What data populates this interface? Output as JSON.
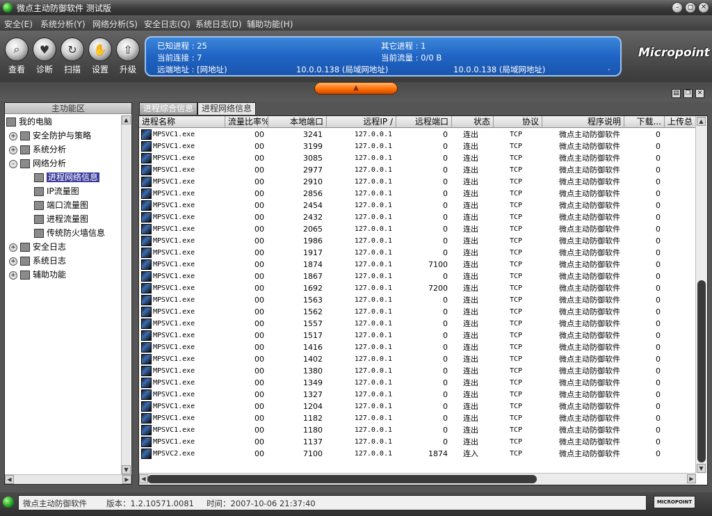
{
  "window": {
    "title": "微点主动防御软件  测试版",
    "btn_min": "–",
    "btn_restore": "◻",
    "btn_close": "✕"
  },
  "menu": [
    "安全(E)",
    "系统分析(Y)",
    "网络分析(S)",
    "安全日志(Q)",
    "系统日志(D)",
    "辅助功能(H)"
  ],
  "toolbar": {
    "buttons": [
      {
        "label": "查看",
        "icon": "magnifier-icon"
      },
      {
        "label": "诊断",
        "icon": "heartbeat-icon"
      },
      {
        "label": "扫描",
        "icon": "scan-icon"
      },
      {
        "label": "设置",
        "icon": "settings-icon"
      },
      {
        "label": "升级",
        "icon": "upgrade-icon"
      }
    ]
  },
  "info": {
    "known_processes": "已知进程 : 25",
    "other_processes": "其它进程 : 1",
    "current_connections": "当前连接 : 7",
    "current_traffic": "当前流量 : 0/0 B",
    "remote_address": "远端地址 : [网地址)",
    "addr1": "10.0.0.138 (局域网地址)",
    "addr2": "10.0.0.138 (局域网地址)",
    "dot": "."
  },
  "brand": "Micropoint",
  "left": {
    "header": "主功能区",
    "tree": [
      {
        "label": "我的电脑",
        "level": 0,
        "expander": "",
        "icon": "computer-icon"
      },
      {
        "label": "安全防护与策略",
        "level": 1,
        "expander": "+",
        "icon": "shield-icon"
      },
      {
        "label": "系统分析",
        "level": 1,
        "expander": "+",
        "icon": "system-icon"
      },
      {
        "label": "网络分析",
        "level": 1,
        "expander": "-",
        "icon": "network-icon"
      },
      {
        "label": "进程网络信息",
        "level": 2,
        "expander": "",
        "icon": "process-net-icon",
        "selected": true
      },
      {
        "label": "IP流量图",
        "level": 2,
        "expander": "",
        "icon": "chart-icon"
      },
      {
        "label": "端口流量图",
        "level": 2,
        "expander": "",
        "icon": "chart-icon"
      },
      {
        "label": "进程流量图",
        "level": 2,
        "expander": "",
        "icon": "chart-icon"
      },
      {
        "label": "传统防火墙信息",
        "level": 2,
        "expander": "",
        "icon": "firewall-icon"
      },
      {
        "label": "安全日志",
        "level": 1,
        "expander": "+",
        "icon": "log-icon"
      },
      {
        "label": "系统日志",
        "level": 1,
        "expander": "+",
        "icon": "log-icon"
      },
      {
        "label": "辅助功能",
        "level": 1,
        "expander": "+",
        "icon": "tools-icon"
      }
    ]
  },
  "tabs": [
    "进程综合信息",
    "进程网络信息"
  ],
  "grid": {
    "columns": [
      "进程名称",
      "流量比率%",
      "本地端口",
      "远程IP /",
      "远程端口",
      "状态",
      "协议",
      "程序说明",
      "下载...",
      "上传总"
    ],
    "rows": [
      [
        "MPSVC1.exe",
        "00",
        "3241",
        "127.0.0.1",
        "0",
        "连出",
        "TCP",
        "微点主动防御软件",
        "0"
      ],
      [
        "MPSVC1.exe",
        "00",
        "3199",
        "127.0.0.1",
        "0",
        "连出",
        "TCP",
        "微点主动防御软件",
        "0"
      ],
      [
        "MPSVC1.exe",
        "00",
        "3085",
        "127.0.0.1",
        "0",
        "连出",
        "TCP",
        "微点主动防御软件",
        "0"
      ],
      [
        "MPSVC1.exe",
        "00",
        "2977",
        "127.0.0.1",
        "0",
        "连出",
        "TCP",
        "微点主动防御软件",
        "0"
      ],
      [
        "MPSVC1.exe",
        "00",
        "2910",
        "127.0.0.1",
        "0",
        "连出",
        "TCP",
        "微点主动防御软件",
        "0"
      ],
      [
        "MPSVC1.exe",
        "00",
        "2856",
        "127.0.0.1",
        "0",
        "连出",
        "TCP",
        "微点主动防御软件",
        "0"
      ],
      [
        "MPSVC1.exe",
        "00",
        "2454",
        "127.0.0.1",
        "0",
        "连出",
        "TCP",
        "微点主动防御软件",
        "0"
      ],
      [
        "MPSVC1.exe",
        "00",
        "2432",
        "127.0.0.1",
        "0",
        "连出",
        "TCP",
        "微点主动防御软件",
        "0"
      ],
      [
        "MPSVC1.exe",
        "00",
        "2065",
        "127.0.0.1",
        "0",
        "连出",
        "TCP",
        "微点主动防御软件",
        "0"
      ],
      [
        "MPSVC1.exe",
        "00",
        "1986",
        "127.0.0.1",
        "0",
        "连出",
        "TCP",
        "微点主动防御软件",
        "0"
      ],
      [
        "MPSVC1.exe",
        "00",
        "1917",
        "127.0.0.1",
        "0",
        "连出",
        "TCP",
        "微点主动防御软件",
        "0"
      ],
      [
        "MPSVC1.exe",
        "00",
        "1874",
        "127.0.0.1",
        "7100",
        "连出",
        "TCP",
        "微点主动防御软件",
        "0"
      ],
      [
        "MPSVC1.exe",
        "00",
        "1867",
        "127.0.0.1",
        "0",
        "连出",
        "TCP",
        "微点主动防御软件",
        "0"
      ],
      [
        "MPSVC1.exe",
        "00",
        "1692",
        "127.0.0.1",
        "7200",
        "连出",
        "TCP",
        "微点主动防御软件",
        "0"
      ],
      [
        "MPSVC1.exe",
        "00",
        "1563",
        "127.0.0.1",
        "0",
        "连出",
        "TCP",
        "微点主动防御软件",
        "0"
      ],
      [
        "MPSVC1.exe",
        "00",
        "1562",
        "127.0.0.1",
        "0",
        "连出",
        "TCP",
        "微点主动防御软件",
        "0"
      ],
      [
        "MPSVC1.exe",
        "00",
        "1557",
        "127.0.0.1",
        "0",
        "连出",
        "TCP",
        "微点主动防御软件",
        "0"
      ],
      [
        "MPSVC1.exe",
        "00",
        "1517",
        "127.0.0.1",
        "0",
        "连出",
        "TCP",
        "微点主动防御软件",
        "0"
      ],
      [
        "MPSVC1.exe",
        "00",
        "1416",
        "127.0.0.1",
        "0",
        "连出",
        "TCP",
        "微点主动防御软件",
        "0"
      ],
      [
        "MPSVC1.exe",
        "00",
        "1402",
        "127.0.0.1",
        "0",
        "连出",
        "TCP",
        "微点主动防御软件",
        "0"
      ],
      [
        "MPSVC1.exe",
        "00",
        "1380",
        "127.0.0.1",
        "0",
        "连出",
        "TCP",
        "微点主动防御软件",
        "0"
      ],
      [
        "MPSVC1.exe",
        "00",
        "1349",
        "127.0.0.1",
        "0",
        "连出",
        "TCP",
        "微点主动防御软件",
        "0"
      ],
      [
        "MPSVC1.exe",
        "00",
        "1327",
        "127.0.0.1",
        "0",
        "连出",
        "TCP",
        "微点主动防御软件",
        "0"
      ],
      [
        "MPSVC1.exe",
        "00",
        "1204",
        "127.0.0.1",
        "0",
        "连出",
        "TCP",
        "微点主动防御软件",
        "0"
      ],
      [
        "MPSVC1.exe",
        "00",
        "1182",
        "127.0.0.1",
        "0",
        "连出",
        "TCP",
        "微点主动防御软件",
        "0"
      ],
      [
        "MPSVC1.exe",
        "00",
        "1180",
        "127.0.0.1",
        "0",
        "连出",
        "TCP",
        "微点主动防御软件",
        "0"
      ],
      [
        "MPSVC1.exe",
        "00",
        "1137",
        "127.0.0.1",
        "0",
        "连出",
        "TCP",
        "微点主动防御软件",
        "0"
      ],
      [
        "MPSVC2.exe",
        "00",
        "7100",
        "127.0.0.1",
        "1874",
        "连入",
        "TCP",
        "微点主动防御软件",
        "0"
      ]
    ]
  },
  "status": {
    "app_name": "微点主动防御软件",
    "version": "版本：1.2.10571.0081",
    "time": "时间：2007-10-06 21:37:40",
    "brand": "MICROPOINT"
  }
}
